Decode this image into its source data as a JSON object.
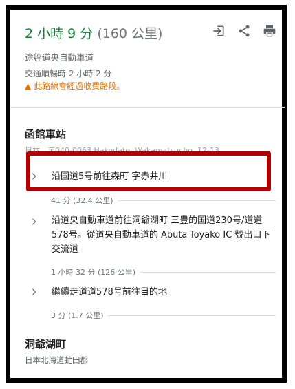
{
  "summary": {
    "duration": "2 小時 9 分",
    "distance": "(160 公里)",
    "via": "途經道央自動車道",
    "traffic": "交通順暢時 2 小時 2 分",
    "toll_warning": "此路線會經過收費路段。"
  },
  "start": {
    "name": "函館車站",
    "address_partial": "日本、〒040-0063 Hakodate, Wakamatsucho, 12-13"
  },
  "steps": [
    {
      "text": "沿国道5号前往森町 字赤井川",
      "segment": "41 分 (32.4 公里)"
    },
    {
      "text": "沿道央自動車道前往洞爺湖町 三豊的国道230号/道道578号。從道央自動車道的 Abuta-Toyako IC 號出口下交流道",
      "segment": "1 小時 32 分 (126 公里)"
    },
    {
      "text": "繼續走道道578号前往目的地",
      "segment": "3 分 (1.7 公里)"
    }
  ],
  "destination": {
    "name": "洞爺湖町",
    "address": "日本北海道虻田郡"
  },
  "icons": {
    "open": "open-in-icon",
    "share": "share-icon",
    "print": "print-icon",
    "warning": "warning-icon",
    "chevron": "chevron-right-icon"
  },
  "colors": {
    "duration_green": "#188038",
    "toll_orange": "#e37400",
    "highlight_red": "#b30000"
  }
}
